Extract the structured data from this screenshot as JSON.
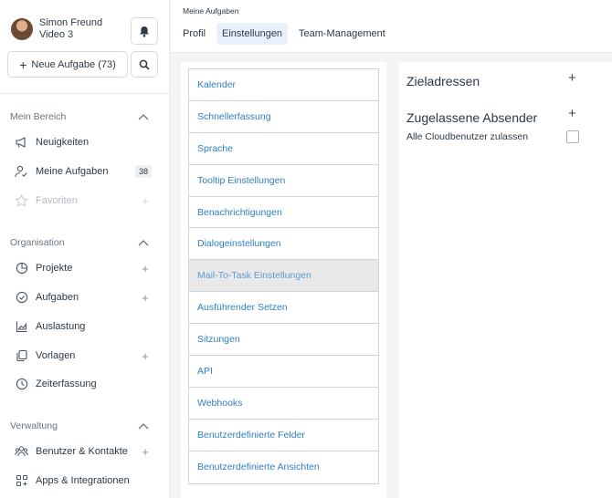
{
  "user": {
    "name": "Simon Freund",
    "subtitle": "Video 3"
  },
  "new_task": {
    "label": "Neue Aufgabe (73)"
  },
  "sidebar": {
    "sections": [
      {
        "title": "Mein Bereich",
        "items": [
          {
            "label": "Neuigkeiten",
            "icon": "megaphone-icon"
          },
          {
            "label": "Meine Aufgaben",
            "icon": "user-check-icon",
            "badge": "38"
          },
          {
            "label": "Favoriten",
            "icon": "star-icon"
          }
        ]
      },
      {
        "title": "Organisation",
        "items": [
          {
            "label": "Projekte",
            "icon": "pie-chart-icon"
          },
          {
            "label": "Aufgaben",
            "icon": "check-circle-icon"
          },
          {
            "label": "Auslastung",
            "icon": "area-chart-icon"
          },
          {
            "label": "Vorlagen",
            "icon": "copy-icon"
          },
          {
            "label": "Zeiterfassung",
            "icon": "clock-icon"
          }
        ]
      },
      {
        "title": "Verwaltung",
        "items": [
          {
            "label": "Benutzer & Kontakte",
            "icon": "users-icon"
          },
          {
            "label": "Apps & Integrationen",
            "icon": "apps-grid-icon"
          }
        ]
      }
    ]
  },
  "header": {
    "breadcrumb": "Meine Aufgaben",
    "tabs": [
      {
        "label": "Profil"
      },
      {
        "label": "Einstellungen",
        "active": true
      },
      {
        "label": "Team-Management"
      }
    ]
  },
  "settings_menu": [
    "Kalender",
    "Schnellerfassung",
    "Sprache",
    "Tooltip Einstellungen",
    "Benachrichtigungen",
    "Dialogeinstellungen",
    "Mail-To-Task Einstellungen",
    "Ausführender Setzen",
    "Sitzungen",
    "API",
    "Webhooks",
    "Benutzerdefinierte Felder",
    "Benutzerdefinierte Ansichten"
  ],
  "active_menu_item": "Mail-To-Task Einstellungen",
  "right_panel": {
    "target_title": "Zieladressen",
    "sender_title": "Zugelassene Absender",
    "allow_cloud_label": "Alle Cloudbenutzer zulassen",
    "allow_cloud_checked": false
  },
  "colors": {
    "accent": "#2f7fc1",
    "active_tab_bg": "#e8f1fb",
    "active_item_bg": "#e9e9e9"
  }
}
